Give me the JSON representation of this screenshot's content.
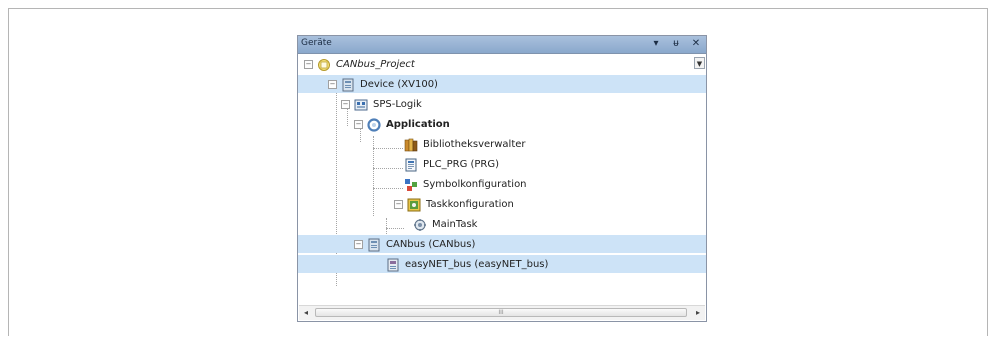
{
  "panel": {
    "title": "Geräte",
    "title_buttons": [
      "▾",
      "ᵾ",
      "✕"
    ]
  },
  "tree": {
    "items": [
      {
        "label": "CANbus_Project",
        "icon": "project-icon",
        "expander": "−"
      },
      {
        "label": "Device (XV100)",
        "icon": "device-icon",
        "expander": "−",
        "selected": true
      },
      {
        "label": "SPS-Logik",
        "icon": "plc-logic-icon",
        "expander": "−"
      },
      {
        "label": "Application",
        "icon": "application-icon",
        "expander": "−"
      },
      {
        "label": "Bibliotheksverwalter",
        "icon": "library-manager-icon"
      },
      {
        "label": "PLC_PRG (PRG)",
        "icon": "program-icon"
      },
      {
        "label": "Symbolkonfiguration",
        "icon": "symbol-config-icon"
      },
      {
        "label": "Taskkonfiguration",
        "icon": "task-config-icon",
        "expander": "−"
      },
      {
        "label": "MainTask",
        "icon": "task-icon"
      },
      {
        "label": "CANbus (CANbus)",
        "icon": "canbus-icon",
        "expander": "−",
        "selected": true
      },
      {
        "label": "easyNET_bus (easyNET_bus)",
        "icon": "easynet-icon",
        "selected": true
      }
    ]
  },
  "scrollbar": {
    "left": "◂",
    "thumb": "III",
    "right": "▸"
  },
  "colors": {
    "selection": "#cde3f7",
    "titlebar": "#a9c0dc"
  }
}
